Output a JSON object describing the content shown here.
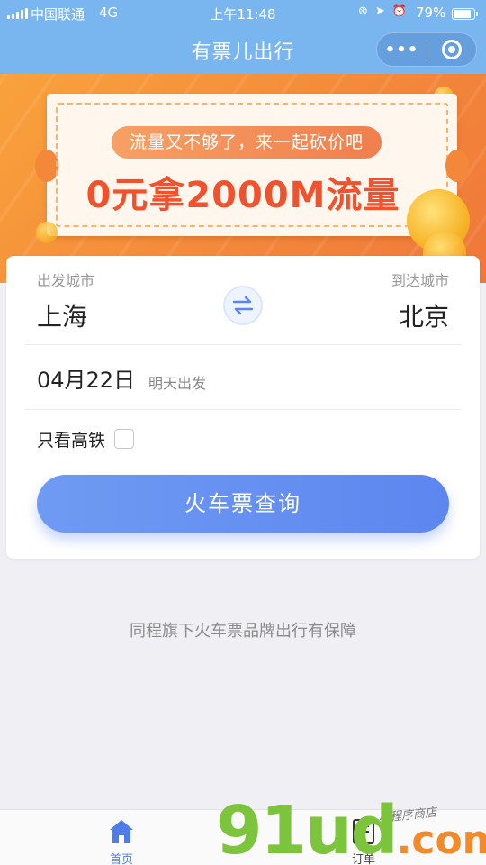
{
  "status_bar": {
    "carrier": "中国联通",
    "network": "4G",
    "time": "上午11:48",
    "battery": "79%",
    "battery_level": 0.79
  },
  "navbar": {
    "title": "有票儿出行",
    "more_label": "•••"
  },
  "banner": {
    "tagline": "流量又不够了，来一起砍价吧",
    "headline": "0元拿2000M流量"
  },
  "search": {
    "from_label": "出发城市",
    "to_label": "到达城市",
    "from_city": "上海",
    "to_city": "北京",
    "date": "04月22日",
    "date_hint": "明天出发",
    "high_speed_only_label": "只看高铁",
    "high_speed_only_checked": false,
    "submit_label": "火车票查询"
  },
  "footer_note": "同程旗下火车票品牌出行有保障",
  "tabbar": {
    "tabs": [
      {
        "label": "首页",
        "icon": "home-icon",
        "active": true
      },
      {
        "label": "订单",
        "icon": "order-list-icon",
        "active": false
      }
    ]
  },
  "watermark": {
    "brand": "91ud",
    "domain": ".com",
    "caption": "小程序商店"
  },
  "colors": {
    "nav_bg": "#79b6f0",
    "accent": "#5d86ef",
    "banner_orange": "#f3873a",
    "headline_red": "#f1522e"
  }
}
